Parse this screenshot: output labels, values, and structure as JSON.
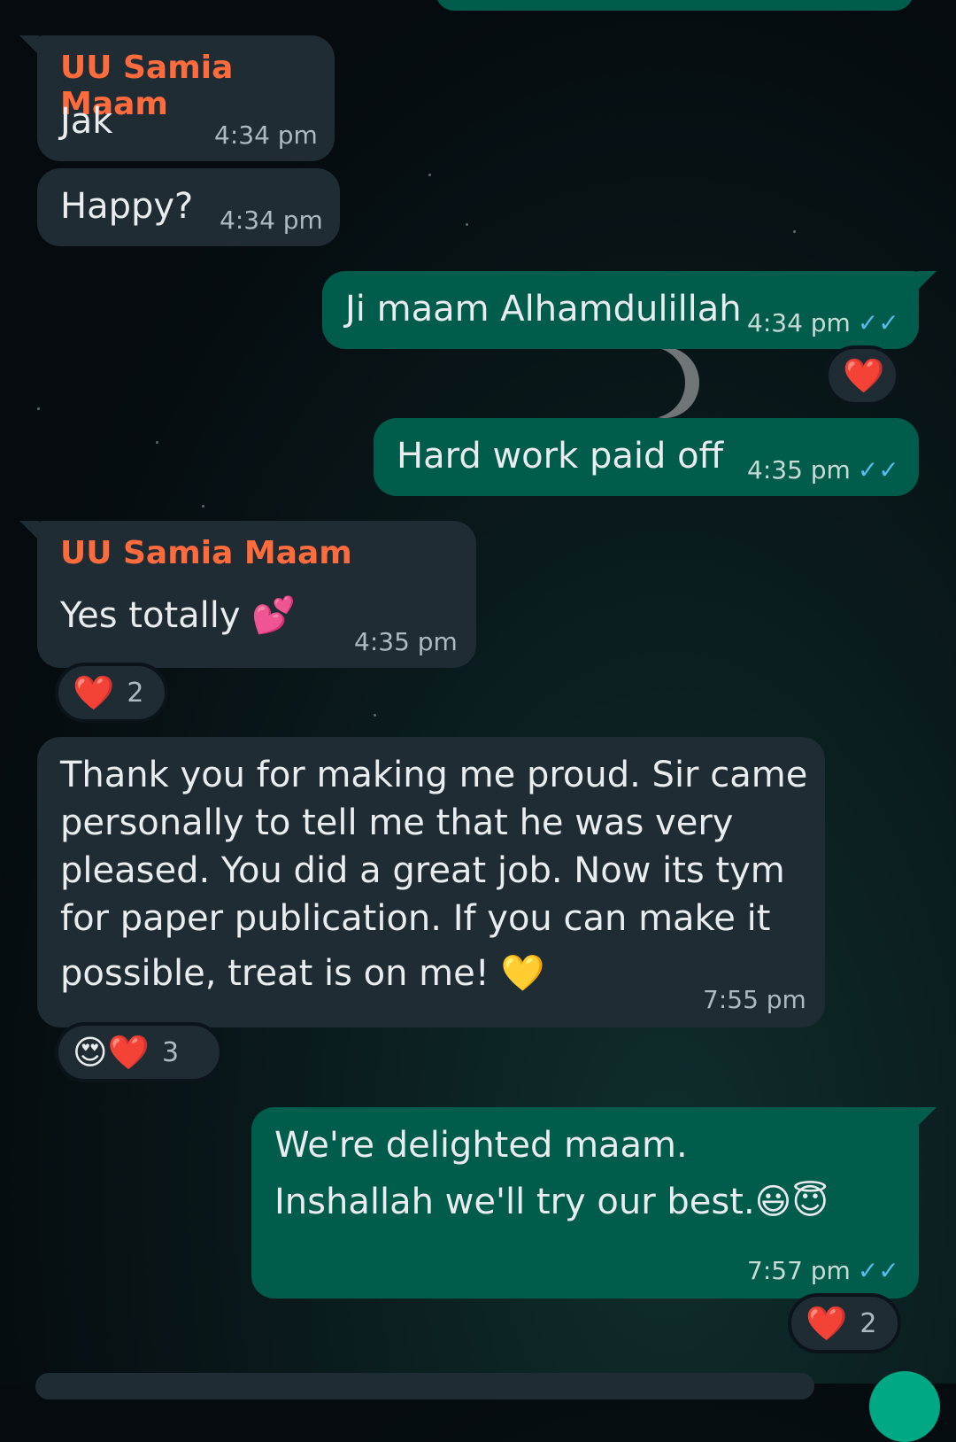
{
  "messages": [
    {
      "direction": "incoming",
      "sender": "UU Samia Maam",
      "text": "Jak",
      "time": "4:34 pm"
    },
    {
      "direction": "incoming",
      "text": "Happy?",
      "time": "4:34 pm"
    },
    {
      "direction": "outgoing",
      "text": "Ji maam Alhamdulillah",
      "time": "4:34 pm",
      "status": "read",
      "reaction": {
        "emoji": "❤️"
      }
    },
    {
      "direction": "outgoing",
      "text": "Hard work paid off",
      "time": "4:35 pm",
      "status": "read"
    },
    {
      "direction": "incoming",
      "sender": "UU Samia Maam",
      "text": "Yes totally 💕",
      "time": "4:35 pm",
      "reaction": {
        "emoji": "❤️",
        "count": "2"
      }
    },
    {
      "direction": "incoming",
      "text_lines": [
        "Thank you for making me proud. Sir came",
        "personally to tell me that he was very",
        "pleased. You did a great job. Now its tym",
        "for paper publication. If you can make it",
        "possible, treat is on me! 💛"
      ],
      "time": "7:55 pm",
      "reaction": {
        "emoji": "😍❤️",
        "count": "3"
      }
    },
    {
      "direction": "outgoing",
      "text_lines": [
        "We're delighted maam.",
        "Inshallah we'll try our best.😃😇"
      ],
      "time": "7:57 pm",
      "status": "read",
      "reaction": {
        "emoji": "❤️",
        "count": "2"
      }
    }
  ],
  "icons": {
    "read_ticks": "✓✓"
  },
  "colors": {
    "incoming_bubble": "#1f2c33",
    "outgoing_bubble": "#005c4b",
    "sender_name": "#ff6b3d",
    "read_tick": "#53bdeb"
  }
}
